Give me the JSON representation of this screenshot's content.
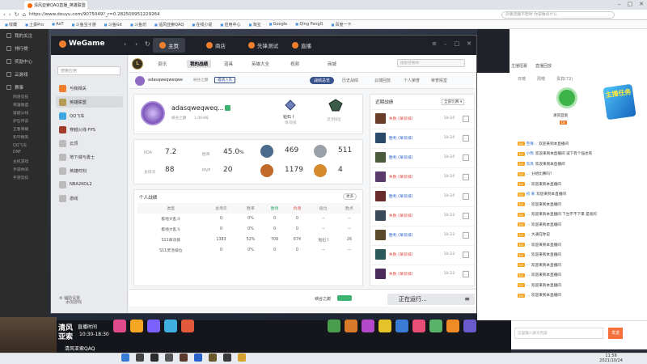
{
  "browser": {
    "tab_title": "清风亚索QAQ直播_英雄联盟",
    "url": "https://www.douyu.com/9075049?_r=0.282500951229264",
    "search_placeholder": "外婆走路不稳时 你该做点什么",
    "bookmarks": [
      "收藏",
      "土豪Pro",
      "AoT",
      "斗鱼宝子游",
      "斗鱼Git",
      "斗鱼坊",
      "遥风亚索QAQ",
      "在线小说",
      "应用中心",
      "淘宝",
      "Google",
      "Qing FengG",
      "百度一下"
    ]
  },
  "douyu_sidebar": {
    "items": [
      "我的关注",
      "排行榜",
      "奖励中心",
      "云游戏",
      "赛事"
    ],
    "subs": [
      "网游竞技",
      "英雄联盟",
      "穿越火线",
      "炉石传说",
      "王者荣耀",
      "和平精英",
      "QQ飞车",
      "DNF",
      "主机游戏",
      "手游休闲",
      "手游竞技"
    ]
  },
  "wegame": {
    "logo": "WeGame",
    "nav": [
      {
        "label": "主页",
        "active": true
      },
      {
        "label": "商店",
        "active": false
      },
      {
        "label": "先锋测试",
        "active": false
      },
      {
        "label": "直播",
        "active": false
      }
    ],
    "search_placeholder": "搜索应用",
    "games": [
      {
        "label": "与我相关",
        "color": "#f07f2d"
      },
      {
        "label": "英雄联盟",
        "color": "#b59a55",
        "active": true
      },
      {
        "label": "QQ飞车",
        "color": "#3fa7e0"
      },
      {
        "label": "穿越火线-FPS",
        "color": "#a03a2a"
      },
      {
        "label": "云顶",
        "color": "#bbbbbb"
      },
      {
        "label": "地下城与勇士",
        "color": "#bbbbbb"
      },
      {
        "label": "英雄时刻",
        "color": "#bbbbbb"
      },
      {
        "label": "NBA2KOL2",
        "color": "#bbbbbb"
      },
      {
        "label": "游戏",
        "color": "#bbbbbb"
      }
    ],
    "add_game": "添加游戏"
  },
  "lol": {
    "subtabs": [
      {
        "label": "资讯",
        "active": false
      },
      {
        "label": "我的战绩",
        "active": true
      },
      {
        "label": "道具",
        "active": false
      },
      {
        "label": "英雄大全",
        "active": false
      },
      {
        "label": "视频",
        "active": false
      },
      {
        "label": "商城",
        "active": false
      }
    ],
    "search_placeholder": "搜索召唤师",
    "player_name_small": "adasqweqweqwe",
    "region_small": "峡谷之巅",
    "invite_btn": "邀请入队",
    "profile_tabs": [
      {
        "label": "战绩总览",
        "active": true
      },
      {
        "label": "历史战绩",
        "active": false
      },
      {
        "label": "云端回放",
        "active": false
      },
      {
        "label": "个人荣誉",
        "active": false
      },
      {
        "label": "荣誉殿堂",
        "active": false
      }
    ],
    "player_name": "adasqweqweq...",
    "region": "峡谷之巅",
    "level": "1,064局",
    "rank_name": "钻石 I",
    "rank_label": "单/双排",
    "rank2_label": "灵活排位",
    "stats": {
      "kda_label": "KDA",
      "kda": "7.2",
      "winrate_label": "胜率",
      "winrate": "45.0",
      "winrate_unit": "%",
      "mvp_label": "总场次",
      "mvp": "88",
      "svp_label": "MVP",
      "svp": "20",
      "e1": "469",
      "e2": "511",
      "e3": "1179",
      "e4": "4"
    },
    "personal_title": "个人战绩",
    "more_btn": "更多",
    "table_headers": [
      "类型",
      "总场次",
      "胜率",
      "胜场",
      "负场",
      "段位",
      "胜点"
    ],
    "table_rows": [
      [
        "极地大乱斗",
        "0",
        "0%",
        "0",
        "0",
        "--",
        "--"
      ],
      [
        "极地大乱斗",
        "0",
        "0%",
        "0",
        "0",
        "--",
        "--"
      ],
      [
        "S11单双排",
        "1383",
        "52%",
        "709",
        "674",
        "钻石 I",
        "26"
      ],
      [
        "S11灵活排位",
        "0",
        "0%",
        "0",
        "0",
        "--",
        "--"
      ]
    ],
    "recent_title": "近期战绩",
    "recent_filter": "全部比赛",
    "recent_matches": [
      {
        "result": "失败 (单双排)",
        "date": "10-24",
        "win": false
      },
      {
        "result": "胜利 (单双排)",
        "date": "10-24",
        "win": true
      },
      {
        "result": "胜利 (单双排)",
        "date": "10-24",
        "win": true
      },
      {
        "result": "失败 (单双排)",
        "date": "10-24",
        "win": false
      },
      {
        "result": "胜利 (单双排)",
        "date": "10-24",
        "win": true
      },
      {
        "result": "失败 (单双排)",
        "date": "10-23",
        "win": false
      },
      {
        "result": "胜利 (单双排)",
        "date": "10-23",
        "win": true
      },
      {
        "result": "失败 (单双排)",
        "date": "10-23",
        "win": false
      },
      {
        "result": "失败 (单双排)",
        "date": "10-23",
        "win": false
      }
    ],
    "bottom_settings": "辅助设置",
    "bottom_server": "峡谷之巅",
    "bottom_running": "正在运行..."
  },
  "douyu_right": {
    "chat_tabs": [
      "主播招募",
      "直播回放"
    ],
    "sub_tabs": [
      "日榜",
      "周榜",
      "贵宾(72)"
    ],
    "host_name": "清风亚索",
    "host_tag": "LV",
    "promo": "主播任务",
    "chat": [
      {
        "user": "至尊...",
        "msg": "欢迎来到本直播间"
      },
      {
        "user": "小熊",
        "msg": "欢迎来到本直播间 减下有个强也有"
      },
      {
        "user": "东风",
        "msg": "欢迎来到本直播间"
      },
      {
        "user": "...",
        "msg": "分组比赛吗？"
      },
      {
        "user": "...",
        "msg": "欢迎来到本直播间"
      },
      {
        "user": "初 来",
        "msg": "欢迎来到本直播间"
      },
      {
        "user": "...",
        "msg": "欢迎来到本直播间"
      },
      {
        "user": "...",
        "msg": "欢迎来到本直播间 下台不不下来 是啥的"
      },
      {
        "user": "...",
        "msg": "欢迎来到本直播间"
      },
      {
        "user": "...",
        "msg": "大通在你说"
      },
      {
        "user": "...",
        "msg": "欢迎来到本直播间"
      },
      {
        "user": "...",
        "msg": "欢迎来到本直播间"
      },
      {
        "user": "...",
        "msg": "欢迎来到本直播间"
      },
      {
        "user": "...",
        "msg": "欢迎来到本直播间"
      },
      {
        "user": "...",
        "msg": "欢迎来到本直播间"
      },
      {
        "user": "...",
        "msg": "欢迎来到本直播间"
      }
    ],
    "input_placeholder": "这里输入聊天内容",
    "send": "发送"
  },
  "cam": {
    "name1": "清风",
    "name2": "亚索",
    "sched1": "直播时间",
    "sched2": "10:30-18:30",
    "id": "清风亚索QAQ",
    "fans": "6167201"
  },
  "taskbar": {
    "time": "11:56",
    "date": "2021/10/24"
  }
}
